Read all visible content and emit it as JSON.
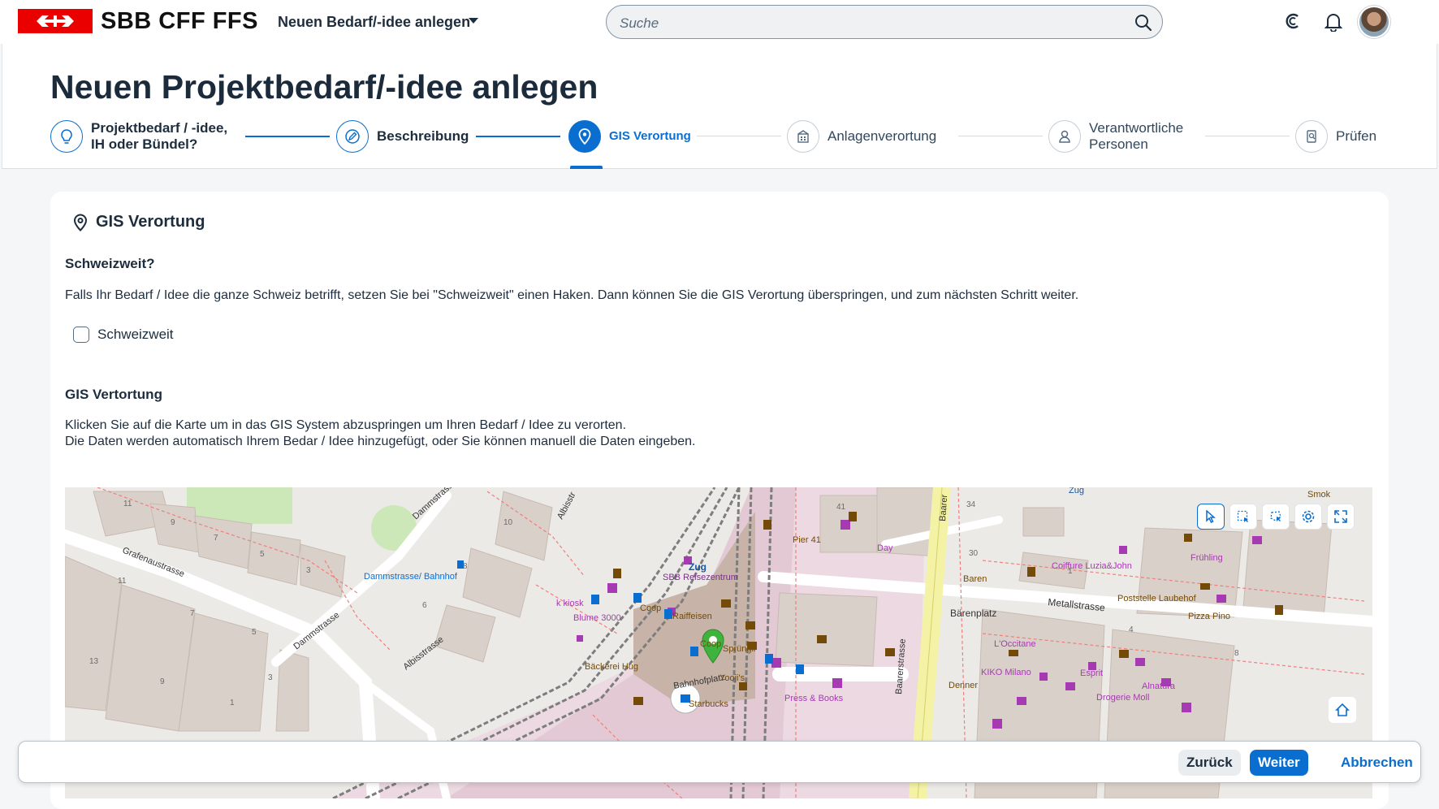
{
  "shell": {
    "brand": "SBB CFF FFS",
    "app_title": "Neuen Bedarf/-idee anlegen",
    "search_placeholder": "Suche",
    "icons": [
      "sbb-logo-icon",
      "chevron-down-icon",
      "search-icon",
      "copilot-icon",
      "bell-icon",
      "user-avatar"
    ]
  },
  "page": {
    "title": "Neuen Projektbedarf/-idee anlegen"
  },
  "wizard": {
    "steps": [
      {
        "label_line1": "Projektbedarf / -idee,",
        "label_line2": "IH oder Bündel?",
        "icon": "lightbulb-icon",
        "state": "done"
      },
      {
        "label_line1": "Beschreibung",
        "label_line2": "",
        "icon": "edit-icon",
        "state": "done"
      },
      {
        "label_line1": "GIS Verortung",
        "label_line2": "",
        "icon": "location-icon",
        "state": "active"
      },
      {
        "label_line1": "Anlagenverortung",
        "label_line2": "",
        "icon": "building-icon",
        "state": "todo"
      },
      {
        "label_line1": "Verantwortliche",
        "label_line2": "Personen",
        "icon": "person-icon",
        "state": "todo"
      },
      {
        "label_line1": "Prüfen",
        "label_line2": "",
        "icon": "review-icon",
        "state": "todo"
      }
    ]
  },
  "card": {
    "title": "GIS Verortung",
    "section1_heading": "Schweizweit?",
    "section1_text": "Falls Ihr Bedarf / Idee die ganze Schweiz betrifft, setzen Sie bei \"Schweizweit\" einen Haken. Dann können Sie die GIS Verortung überspringen, und zum nächsten Schritt weiter.",
    "checkbox_label": "Schweizweit",
    "checkbox_checked": false,
    "section2_heading": "GIS Vertortung",
    "section2_line1": "Klicken Sie auf die Karte um in das GIS System abzuspringen um Ihren Bedarf / Idee zu verorten.",
    "section2_line2": "Die Daten werden automatisch Ihrem Bedar / Idee hinzugefügt, oder Sie können manuell die Daten eingeben."
  },
  "map": {
    "labels": {
      "grafenaustrasse": "Grafenaustrasse",
      "dammstrasse": "Dammstrasse",
      "dammstrasse2": "Dammstrasse",
      "albisstrasse": "Albisstrasse",
      "albisstr_top": "Albisstr",
      "stop": "Dammstrasse/ Bahnhof",
      "zug": "Zug",
      "reisezentrum": "SBB Reisezentrum",
      "coop": "Coop",
      "raiffeisen": "Raiffeisen",
      "coop2": "Coop",
      "kiosk": "k kiosk",
      "blume": "Blume 3000",
      "baeckerei": "Bäckerei Hug",
      "bahnhofplatz": "Bahnhofplatz",
      "starbucks": "Starbucks",
      "spruengli": "Sprüngli",
      "yooji": "Yooji's",
      "press": "Press & Books",
      "pier": "Pier 41",
      "day": "Day",
      "baren": "Baren",
      "baarerstrasse": "Baarerstrasse",
      "baarerstrasse2": "Baarer",
      "baerenplatz": "Bärenplatz",
      "metallstrasse": "Metallstrasse",
      "occitane": "L'Occitane",
      "kiko": "KIKO Milano",
      "denner": "Denner",
      "esprit": "Esprit",
      "alnatura": "Alnatura",
      "drogerie": "Drogerie Moll",
      "coiffure": "Coiffure Luzia&John",
      "poststelle": "Poststelle Laubehof",
      "fruehling": "Frühling",
      "pizza": "Pizza Pino",
      "zug2": "Zug",
      "smok": "Smok"
    },
    "house_numbers": [
      "11",
      "9",
      "7",
      "5",
      "3",
      "11",
      "7",
      "5",
      "13",
      "9",
      "3",
      "1",
      "10",
      "8",
      "6",
      "41",
      "34",
      "30",
      "1",
      "4",
      "8"
    ],
    "tools": [
      "pointer-tool-icon",
      "box-select-icon",
      "lasso-select-icon",
      "settings-icon",
      "fullscreen-icon",
      "home-icon"
    ]
  },
  "footer": {
    "back": "Zurück",
    "next": "Weiter",
    "cancel": "Abbrechen"
  }
}
